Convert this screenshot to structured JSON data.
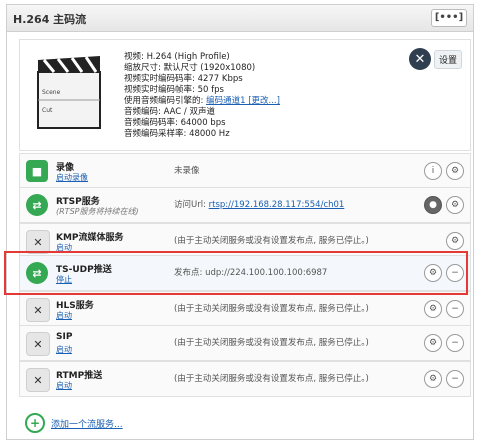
{
  "header": {
    "title": "H.264 主码流",
    "menu_label": "[•••]"
  },
  "info": {
    "clapper_labels": [
      "Scene",
      "Cut"
    ],
    "lines": [
      {
        "text": "视频: H.264 (High Profile)"
      },
      {
        "text": "缩放尺寸: 默认尺寸 (1920x1080)"
      },
      {
        "text": "视频实时编码码率: 4277 Kbps"
      },
      {
        "text": "视频实时编码帧率: 50 fps"
      },
      {
        "text": "使用音频编码引擎的: ",
        "link": "编码通道1",
        "after": " [更改...]"
      },
      {
        "text": "音频编码: AAC / 双声道"
      },
      {
        "text": "音频编码码率: 64000 bps"
      },
      {
        "text": "音频编码采样率: 48000 Hz"
      }
    ],
    "settings_label": "设置"
  },
  "rows": [
    {
      "name": "录像",
      "sub": "启动录像",
      "status": "未录像",
      "icon": "record-square-icon",
      "controls": [
        "info-icon",
        "gear-icon"
      ]
    },
    {
      "name": "RTSP服务",
      "sub": "(RTSP服务将持续在线)",
      "status_prefix": "访问Url: ",
      "status_link": "rtsp://192.168.28.117:554/ch01",
      "icon": "swap-arrows-icon",
      "controls": [
        "person-icon",
        "gear-icon"
      ]
    },
    {
      "name": "KMP流媒体服务",
      "sub": "启动",
      "status": "(由于主动关闭服务或没有设置发布点, 服务已停止。)",
      "icon": "close-x-icon",
      "controls": [
        "gear-icon"
      ]
    },
    {
      "name": "TS-UDP推送",
      "sub": "停止",
      "status": "发布点: udp://224.100.100.100:6987",
      "icon": "swap-arrows-icon",
      "controls": [
        "gear-icon",
        "minus-icon"
      ]
    },
    {
      "name": "HLS服务",
      "sub": "启动",
      "status": "(由于主动关闭服务或没有设置发布点, 服务已停止。)",
      "icon": "close-x-icon",
      "controls": [
        "gear-icon",
        "minus-icon"
      ]
    },
    {
      "name": "SIP",
      "sub": "启动",
      "status": "(由于主动关闭服务或没有设置发布点, 服务已停止。)",
      "icon": "close-x-icon",
      "controls": [
        "gear-icon",
        "minus-icon"
      ]
    },
    {
      "name": "RTMP推送",
      "sub": "启动",
      "status": "(由于主动关闭服务或没有设置发布点, 服务已停止。)",
      "icon": "close-x-icon",
      "controls": [
        "gear-icon",
        "minus-icon"
      ]
    }
  ],
  "add_stream": "添加一个流服务...",
  "colors": {
    "accent": "#34a853",
    "link": "#1a5fb4",
    "highlight": "#e53935"
  }
}
